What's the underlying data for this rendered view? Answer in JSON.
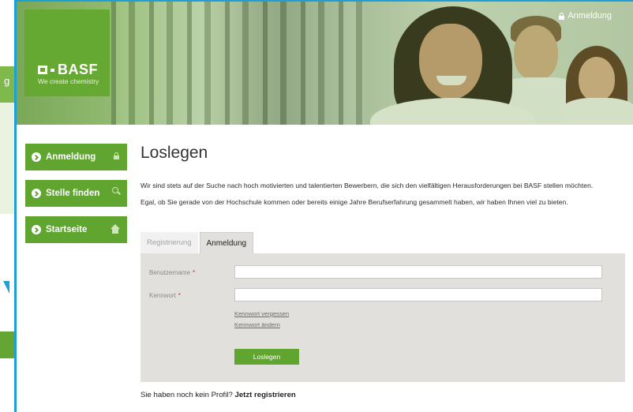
{
  "header": {
    "logo_text": "BASF",
    "tagline": "We create chemistry",
    "top_login_label": "Anmeldung"
  },
  "background_page": {
    "panel_letter": "g"
  },
  "sidebar": {
    "items": [
      {
        "label": "Anmeldung",
        "icon": "lock-icon"
      },
      {
        "label": "Stelle finden",
        "icon": "search-icon"
      },
      {
        "label": "Startseite",
        "icon": "home-icon"
      }
    ]
  },
  "main": {
    "title": "Loslegen",
    "intro_1": "Wir sind stets auf der Suche nach hoch motivierten und talentierten Bewerbern, die sich den vielfältigen Herausforderungen bei BASF stellen möchten.",
    "intro_2": "Egal, ob Sie gerade von der Hochschule kommen oder bereits einige Jahre Berufserfahrung gesammelt haben, wir haben Ihnen viel zu bieten."
  },
  "tabs": [
    {
      "label": "Registrierung",
      "active": false
    },
    {
      "label": "Anmeldung",
      "active": true
    }
  ],
  "form": {
    "username_label": "Benutzername",
    "password_label": "Kennwort",
    "required_marker": "*",
    "username_value": "",
    "password_value": "",
    "forgot_password_link": "Kennwort vergessen",
    "change_password_link": "Kennwort ändern",
    "submit_label": "Loslegen"
  },
  "footer": {
    "no_profile_text": "Sie haben noch kein Profil?",
    "register_link": "Jetzt registrieren"
  },
  "colors": {
    "brand_green": "#5fa52f",
    "frame_blue": "#1e9fd8",
    "panel_gray": "#e2e0dd",
    "required_red": "#d0342c"
  }
}
